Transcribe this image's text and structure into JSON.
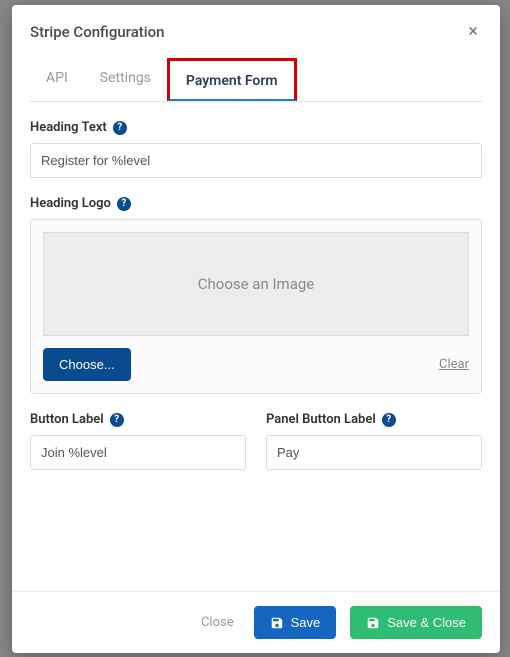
{
  "modal": {
    "title": "Stripe Configuration"
  },
  "tabs": [
    {
      "label": "API"
    },
    {
      "label": "Settings"
    },
    {
      "label": "Payment Form"
    }
  ],
  "fields": {
    "heading_text": {
      "label": "Heading Text",
      "value": "Register for %level"
    },
    "heading_logo": {
      "label": "Heading Logo",
      "placeholder": "Choose an Image",
      "choose": "Choose...",
      "clear": "Clear"
    },
    "button_label": {
      "label": "Button Label",
      "value": "Join %level"
    },
    "panel_button_label": {
      "label": "Panel Button Label",
      "value": "Pay"
    }
  },
  "footer": {
    "close": "Close",
    "save": "Save",
    "save_close": "Save & Close"
  }
}
